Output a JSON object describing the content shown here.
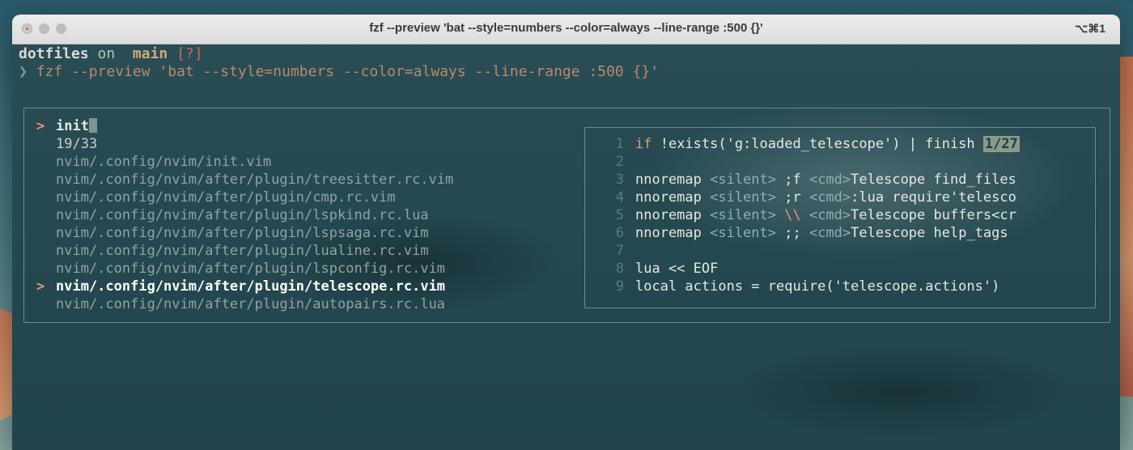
{
  "window": {
    "title": "fzf --preview 'bat --style=numbers --color=always --line-range :500 {}'",
    "shortcut": "⌥⌘1"
  },
  "prompt": {
    "dir": "dotfiles",
    "on": "on",
    "branch_icon": "",
    "branch": "main",
    "status": "[?]",
    "chevron": "❯",
    "command": "fzf --preview 'bat --style=numbers --color=always --line-range :500 {}'"
  },
  "fzf": {
    "prompt_marker": ">",
    "query": "init",
    "count": "19/33",
    "selected_marker": ">",
    "results": [
      "nvim/.config/nvim/init.vim",
      "nvim/.config/nvim/after/plugin/treesitter.rc.vim",
      "nvim/.config/nvim/after/plugin/cmp.rc.vim",
      "nvim/.config/nvim/after/plugin/lspkind.rc.lua",
      "nvim/.config/nvim/after/plugin/lspsaga.rc.vim",
      "nvim/.config/nvim/after/plugin/lualine.rc.vim",
      "nvim/.config/nvim/after/plugin/lspconfig.rc.vim",
      "nvim/.config/nvim/after/plugin/telescope.rc.vim",
      "nvim/.config/nvim/after/plugin/autopairs.rc.lua"
    ]
  },
  "preview": {
    "position": "1/27",
    "lines": [
      {
        "n": "1",
        "a": "if",
        "b": " !exists('g:loaded_telescope') | finish"
      },
      {
        "n": "2",
        "a": "",
        "b": ""
      },
      {
        "n": "3",
        "a": "nnoremap ",
        "t": "<silent>",
        "b": " ;f ",
        "t2": "<cmd>",
        "c": "Telescope find_files"
      },
      {
        "n": "4",
        "a": "nnoremap ",
        "t": "<silent>",
        "b": " ;r ",
        "t2": "<cmd>",
        "c": ":lua require'telesco"
      },
      {
        "n": "5",
        "a": "nnoremap ",
        "t": "<silent>",
        "b": " \\\\ ",
        "t2": "<cmd>",
        "c": "Telescope buffers<cr"
      },
      {
        "n": "6",
        "a": "nnoremap ",
        "t": "<silent>",
        "b": " ;; ",
        "t2": "<cmd>",
        "c": "Telescope help_tags"
      },
      {
        "n": "7",
        "a": "",
        "b": ""
      },
      {
        "n": "8",
        "a": "lua << EOF",
        "b": ""
      },
      {
        "n": "9",
        "a": "local actions = require('telescope.actions')",
        "b": ""
      }
    ]
  },
  "colors": {
    "accent": "#e09a73",
    "text": "#e6e8e2",
    "muted": "#8fa3a5",
    "border": "#6f8a8c"
  }
}
